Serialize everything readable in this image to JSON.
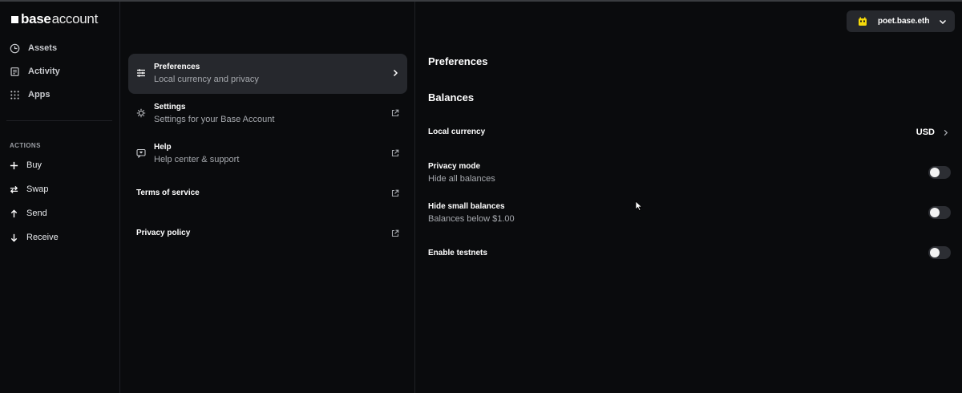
{
  "brand": {
    "bold": "base",
    "light": "account"
  },
  "sidebar": {
    "items": [
      {
        "label": "Assets",
        "icon": "clock-icon"
      },
      {
        "label": "Activity",
        "icon": "document-icon"
      },
      {
        "label": "Apps",
        "icon": "grid-icon"
      }
    ],
    "actions_title": "ACTIONS",
    "actions": [
      {
        "label": "Buy",
        "icon": "plus-icon"
      },
      {
        "label": "Swap",
        "icon": "swap-icon"
      },
      {
        "label": "Send",
        "icon": "arrow-up-icon"
      },
      {
        "label": "Receive",
        "icon": "arrow-down-icon"
      }
    ]
  },
  "menu": {
    "items": [
      {
        "title": "Preferences",
        "subtitle": "Local currency and privacy",
        "icon": "sliders-icon",
        "active": true
      },
      {
        "title": "Settings",
        "subtitle": "Settings for your Base Account",
        "icon": "gear-icon"
      },
      {
        "title": "Help",
        "subtitle": "Help center & support",
        "icon": "chat-icon"
      },
      {
        "title": "Terms of service"
      },
      {
        "title": "Privacy policy"
      }
    ]
  },
  "panel": {
    "title": "Preferences",
    "section": "Balances",
    "local_currency": {
      "title": "Local currency",
      "value": "USD"
    },
    "privacy_mode": {
      "title": "Privacy mode",
      "subtitle": "Hide all balances",
      "enabled": false
    },
    "hide_small": {
      "title": "Hide small balances",
      "subtitle": "Balances below $1.00",
      "enabled": false
    },
    "testnets": {
      "title": "Enable testnets",
      "enabled": false
    }
  },
  "account": {
    "name": "poet.base.eth",
    "avatar_color": "#f5d90a"
  },
  "colors": {
    "background": "#0a0b0d",
    "active_item": "#26282d",
    "muted_text": "#a6a9ae"
  }
}
